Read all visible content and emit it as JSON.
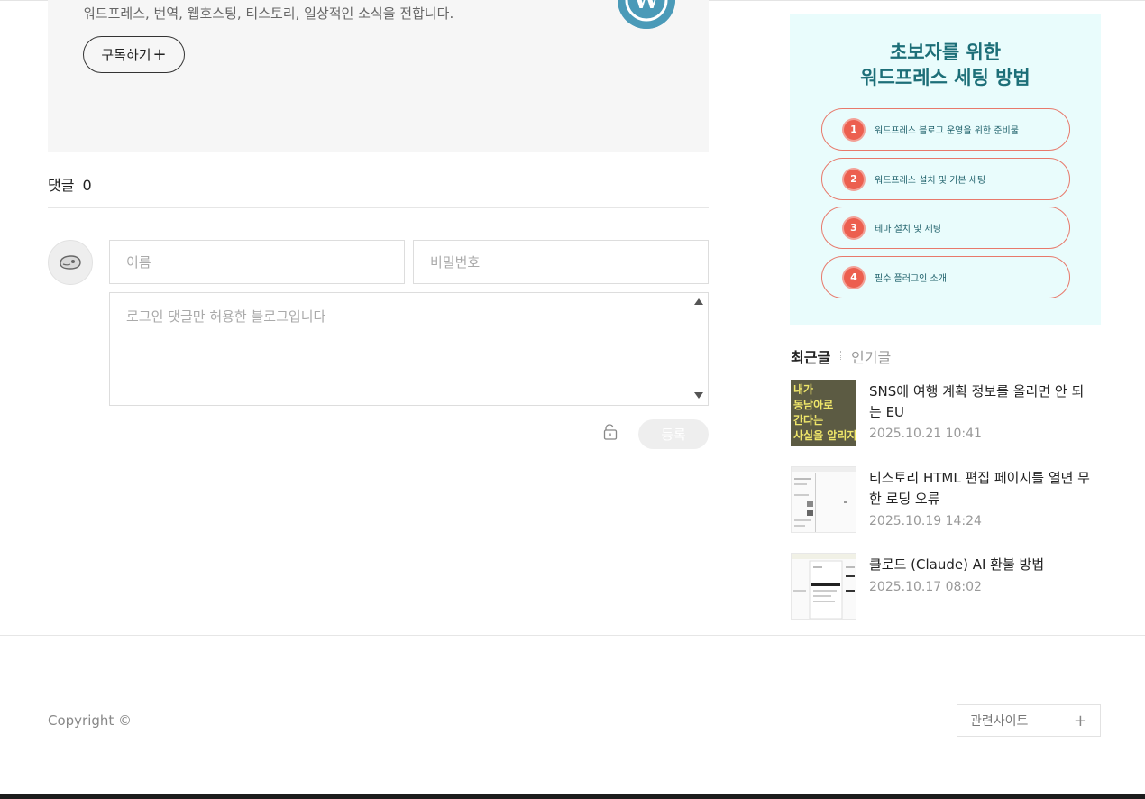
{
  "blog_info": {
    "description": "워드프레스, 번역, 웹호스팅, 티스토리, 일상적인 소식을 전합니다.",
    "subscribe_label": "구독하기",
    "subscribe_icon": "plus-icon"
  },
  "comments": {
    "title": "댓글",
    "count": "0",
    "name_placeholder": "이름",
    "password_placeholder": "비밀번호",
    "text_placeholder": "로그인 댓글만 허용한 블로그입니다",
    "submit_label": "등록"
  },
  "banner": {
    "title_line1": "초보자를 위한",
    "title_line2": "워드프레스 세팅 방법",
    "items": [
      {
        "num": "1",
        "label": "워드프레스 블로그 운영을 위한 준비물"
      },
      {
        "num": "2",
        "label": "워드프레스 설치 및 기본 세팅"
      },
      {
        "num": "3",
        "label": "테마 설치 및 세팅"
      },
      {
        "num": "4",
        "label": "필수 플러그인 소개"
      }
    ],
    "colors": {
      "background": "#e9fcfc",
      "title": "#1d6f78",
      "badge": "#ec5f4f",
      "border": "#e8796b"
    }
  },
  "sidebar": {
    "tab_recent": "최근글",
    "tab_popular": "인기글",
    "posts": [
      {
        "title": "SNS에 여행 계획 정보를 올리면 안 되는 EU",
        "date": "2025.10.21 10:41",
        "thumb_text": [
          "내가",
          "동남아로",
          "간다는",
          "사실을 알리지."
        ]
      },
      {
        "title": "티스토리 HTML 편집 페이지를 열면 무한 로딩 오류",
        "date": "2025.10.19 14:24"
      },
      {
        "title": "클로드 (Claude) AI 환불 방법",
        "date": "2025.10.17 08:02"
      }
    ]
  },
  "footer": {
    "copyright": "Copyright ©",
    "related_sites": "관련사이트"
  }
}
